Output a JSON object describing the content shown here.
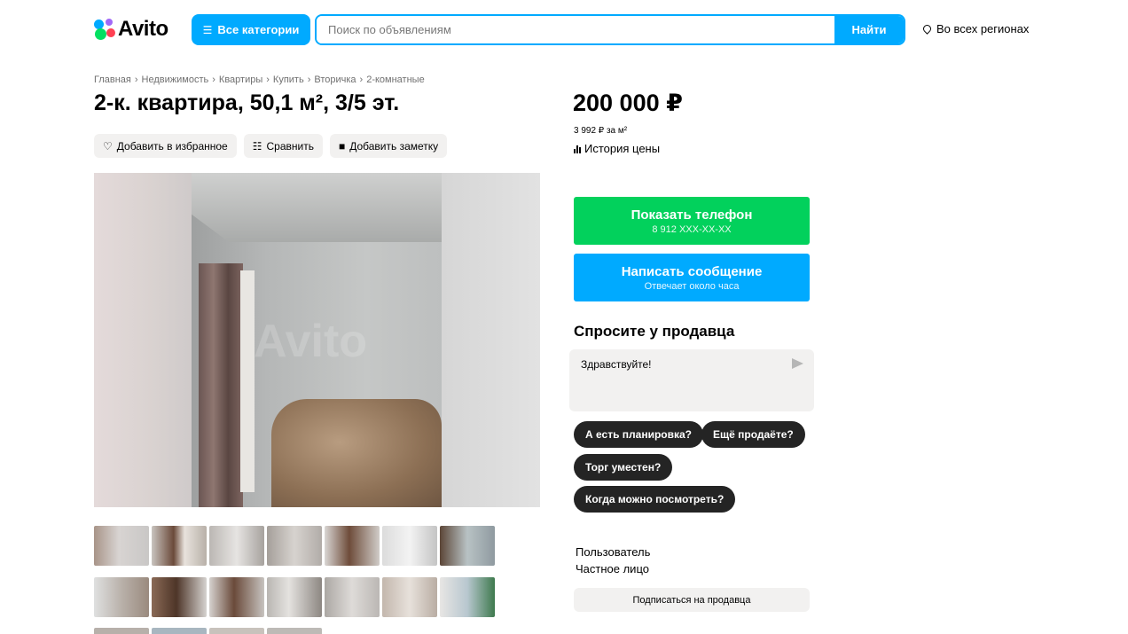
{
  "header": {
    "logo_text": "Avito",
    "categories_label": "Все категории",
    "search_placeholder": "Поиск по объявлениям",
    "search_button": "Найти",
    "region": "Во всех регионах"
  },
  "breadcrumbs": [
    "Главная",
    "Недвижимость",
    "Квартиры",
    "Купить",
    "Вторичка",
    "2-комнатные"
  ],
  "listing": {
    "title": "2-к. квартира, 50,1 м², 3/5 эт.",
    "actions": {
      "favorite": "Добавить в избранное",
      "compare": "Сравнить",
      "note": "Добавить заметку"
    },
    "watermark": "Avito"
  },
  "price": {
    "value": "200 000 ₽",
    "per_m2": "3 992 ₽ за м²",
    "history": "История цены"
  },
  "contact": {
    "phone_label": "Показать телефон",
    "phone_sub": "8 912 XXX-XX-XX",
    "message_label": "Написать сообщение",
    "message_sub": "Отвечает около часа"
  },
  "ask": {
    "title": "Спросите у продавца",
    "message_value": "Здравствуйте!",
    "chips": [
      "А есть планировка?",
      "Ещё продаёте?",
      "Торг уместен?",
      "Когда можно посмотреть?"
    ]
  },
  "seller": {
    "name": "Пользователь",
    "type": "Частное лицо",
    "subscribe": "Подписаться на продавца"
  },
  "colors": {
    "brand_blue": "#00aaff",
    "phone_green": "#02d15c",
    "chip_dark": "#242424"
  }
}
